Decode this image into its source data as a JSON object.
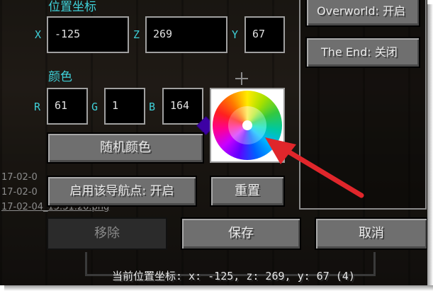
{
  "position": {
    "title": "位置坐标",
    "x_label": "X",
    "x_value": "-125",
    "z_label": "Z",
    "z_value": "269",
    "y_label": "Y",
    "y_value": "67"
  },
  "color": {
    "title": "颜色",
    "r_label": "R",
    "r_value": "61",
    "g_label": "G",
    "g_value": "1",
    "b_label": "B",
    "b_value": "164",
    "swatch": "#3d01a4"
  },
  "buttons": {
    "random_color": "随机颜色",
    "enable_waypoint": "启用该导航点: 开启",
    "reset": "重置",
    "remove": "移除",
    "save": "保存",
    "cancel": "取消"
  },
  "dimensions": {
    "overworld": "Overworld: 开启",
    "the_end": "The End: 关闭"
  },
  "background_files": [
    "17-02-0",
    "17-02-0",
    "17-02-04_15.31.20.png"
  ],
  "status_bar": "当前位置坐标: x: -125, z: 269, y: 67 (4)",
  "annotation_color": "#e0262b"
}
